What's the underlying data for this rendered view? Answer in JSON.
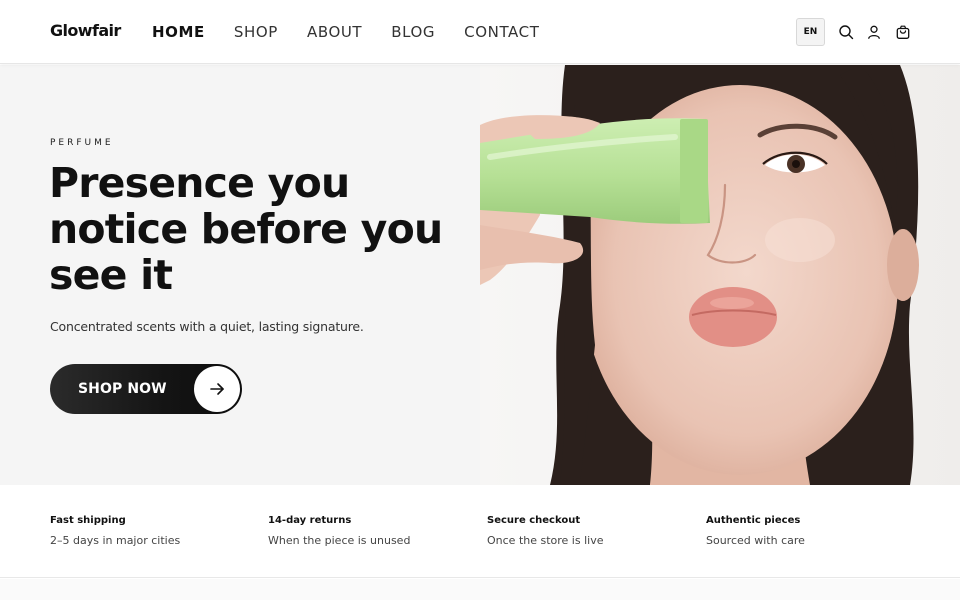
{
  "brand": {
    "logo": "Glowfair"
  },
  "nav": {
    "items": [
      {
        "label": "HOME",
        "active": true
      },
      {
        "label": "SHOP",
        "active": false
      },
      {
        "label": "ABOUT",
        "active": false
      },
      {
        "label": "BLOG",
        "active": false
      },
      {
        "label": "CONTACT",
        "active": false
      }
    ]
  },
  "header_actions": {
    "language": "EN",
    "icons": [
      "search-icon",
      "user-icon",
      "shopping-bag-icon"
    ]
  },
  "hero": {
    "eyebrow": "PERFUME",
    "headline": "Presence you notice before you see it",
    "subtext": "Concentrated scents with a quiet, lasting signature.",
    "cta_label": "SHOP NOW",
    "cta_icon": "arrow-right-icon",
    "image_subject": "woman holding green tube over eye"
  },
  "features": [
    {
      "title": "Fast shipping",
      "text": "2–5 days in major cities"
    },
    {
      "title": "14-day returns",
      "text": "When the piece is unused"
    },
    {
      "title": "Secure checkout",
      "text": "Once the store is live"
    },
    {
      "title": "Authentic pieces",
      "text": "Sourced with care"
    }
  ],
  "colors": {
    "text": "#111111",
    "hero_bg": "#f5f5f5",
    "cta_bg": "#141414",
    "tube_green": "#b8e39a"
  }
}
